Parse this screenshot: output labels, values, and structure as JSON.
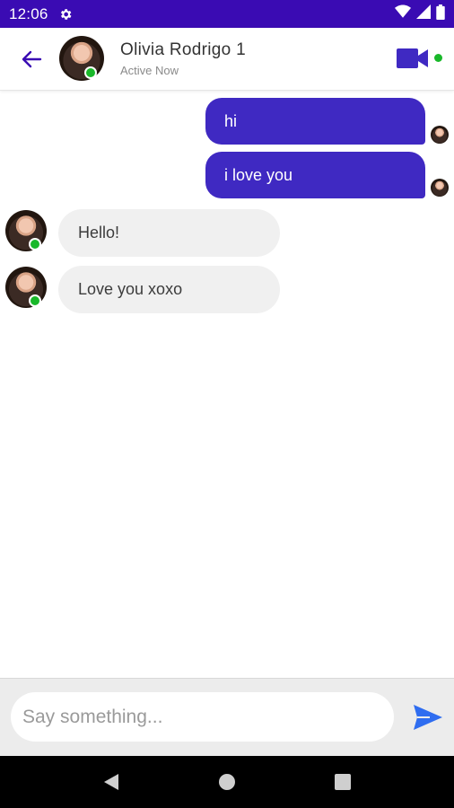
{
  "status_bar": {
    "time": "12:06",
    "icons": [
      "gear-icon",
      "wifi-icon",
      "signal-icon",
      "battery-icon"
    ]
  },
  "header": {
    "name": "Olivia Rodrigo 1",
    "status": "Active Now"
  },
  "messages": [
    {
      "direction": "out",
      "text": "hi"
    },
    {
      "direction": "out",
      "text": "i love you"
    },
    {
      "direction": "in",
      "text": "Hello!"
    },
    {
      "direction": "in",
      "text": "Love you xoxo"
    }
  ],
  "composer": {
    "placeholder": "Say something...",
    "value": ""
  },
  "colors": {
    "accent": "#3a0bb3",
    "bubble_out": "#3f29c2",
    "bubble_in": "#f0f0f0",
    "online": "#19b82a"
  },
  "nav": [
    "back-triangle-icon",
    "home-circle-icon",
    "recents-square-icon"
  ]
}
